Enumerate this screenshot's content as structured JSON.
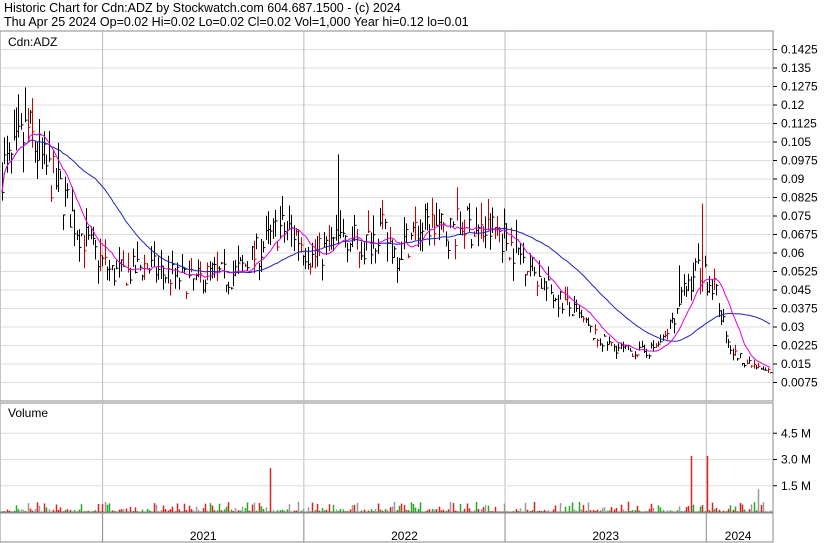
{
  "header": {
    "line1": "Historic Chart for Cdn:ADZ by Stockwatch.com 604.687.1500 - (c) 2024",
    "line2": "Thu Apr 25 2024   Op=0.02  Hi=0.02  Lo=0.02  Cl=0.02  Vol=1,000  Year hi=0.12  lo=0.01"
  },
  "colors": {
    "price_bar": "#000000",
    "red_tick": "#cc0000",
    "ma_short": "#e000e0",
    "ma_long": "#2020c0",
    "vol_up": "#22aa22",
    "vol_down": "#dd2222",
    "vol_neutral": "#999999",
    "grid": "#dddddd",
    "border": "#888888"
  },
  "chart_data": [
    {
      "type": "line",
      "title": "Cdn:ADZ",
      "x_range": [
        "2020-07",
        "2024-04"
      ],
      "ylim": [
        0.0,
        0.15
      ],
      "y_ticks": [
        "0.1425",
        "0.135",
        "0.1275",
        "0.12",
        "0.1125",
        "0.105",
        "0.0975",
        "0.09",
        "0.0825",
        "0.075",
        "0.0675",
        "0.06",
        "0.0525",
        "0.045",
        "0.0375",
        "0.03",
        "0.0225",
        "0.015",
        "0.0075"
      ],
      "x_labels": [
        "2021",
        "2022",
        "2023",
        "2024"
      ],
      "price_knots": [
        [
          "2020-07",
          0.095
        ],
        [
          "2020-08",
          0.11
        ],
        [
          "2020-09",
          0.095
        ],
        [
          "2020-10",
          0.085
        ],
        [
          "2020-11",
          0.07
        ],
        [
          "2020-12",
          0.06
        ],
        [
          "2021-01",
          0.052
        ],
        [
          "2021-02",
          0.052
        ],
        [
          "2021-03",
          0.055
        ],
        [
          "2021-04",
          0.052
        ],
        [
          "2021-05",
          0.05
        ],
        [
          "2021-06",
          0.048
        ],
        [
          "2021-07",
          0.052
        ],
        [
          "2021-08",
          0.05
        ],
        [
          "2021-09",
          0.055
        ],
        [
          "2021-10",
          0.062
        ],
        [
          "2021-11",
          0.07
        ],
        [
          "2021-12",
          0.068
        ],
        [
          "2022-01",
          0.058
        ],
        [
          "2022-02",
          0.062
        ],
        [
          "2022-03",
          0.068
        ],
        [
          "2022-04",
          0.062
        ],
        [
          "2022-05",
          0.07
        ],
        [
          "2022-06",
          0.06
        ],
        [
          "2022-07",
          0.068
        ],
        [
          "2022-08",
          0.072
        ],
        [
          "2022-09",
          0.068
        ],
        [
          "2022-10",
          0.072
        ],
        [
          "2022-11",
          0.068
        ],
        [
          "2022-12",
          0.07
        ],
        [
          "2023-01",
          0.062
        ],
        [
          "2023-02",
          0.055
        ],
        [
          "2023-03",
          0.045
        ],
        [
          "2023-04",
          0.04
        ],
        [
          "2023-05",
          0.033
        ],
        [
          "2023-06",
          0.025
        ],
        [
          "2023-07",
          0.022
        ],
        [
          "2023-08",
          0.02
        ],
        [
          "2023-09",
          0.02
        ],
        [
          "2023-10",
          0.025
        ],
        [
          "2023-11",
          0.042
        ],
        [
          "2023-12",
          0.055
        ],
        [
          "2024-01",
          0.045
        ],
        [
          "2024-02",
          0.02
        ],
        [
          "2024-03",
          0.015
        ],
        [
          "2024-04",
          0.012
        ]
      ],
      "spikes": [
        {
          "x": "2022-03",
          "high": 0.1
        },
        {
          "x": "2023-12",
          "high": 0.08
        },
        {
          "x": "2023-11",
          "high": 0.055
        }
      ],
      "series": [
        {
          "name": "price_bars",
          "color": "#000000"
        },
        {
          "name": "short_moving_average",
          "color": "#e000e0"
        },
        {
          "name": "long_moving_average",
          "color": "#2020c0"
        }
      ]
    },
    {
      "type": "bar",
      "title": "Volume",
      "y_ticks": [
        "4.5 M",
        "3.0 M",
        "1.5 M"
      ],
      "ylim": [
        0,
        6000000
      ],
      "typical_max": 600000,
      "spikes": [
        {
          "x": "2021-11",
          "value": 2500000
        },
        {
          "x": "2023-12",
          "value": 3200000
        },
        {
          "x": "2024-01",
          "value": 3200000
        },
        {
          "x": "2024-04",
          "value": 1300000
        }
      ]
    }
  ]
}
